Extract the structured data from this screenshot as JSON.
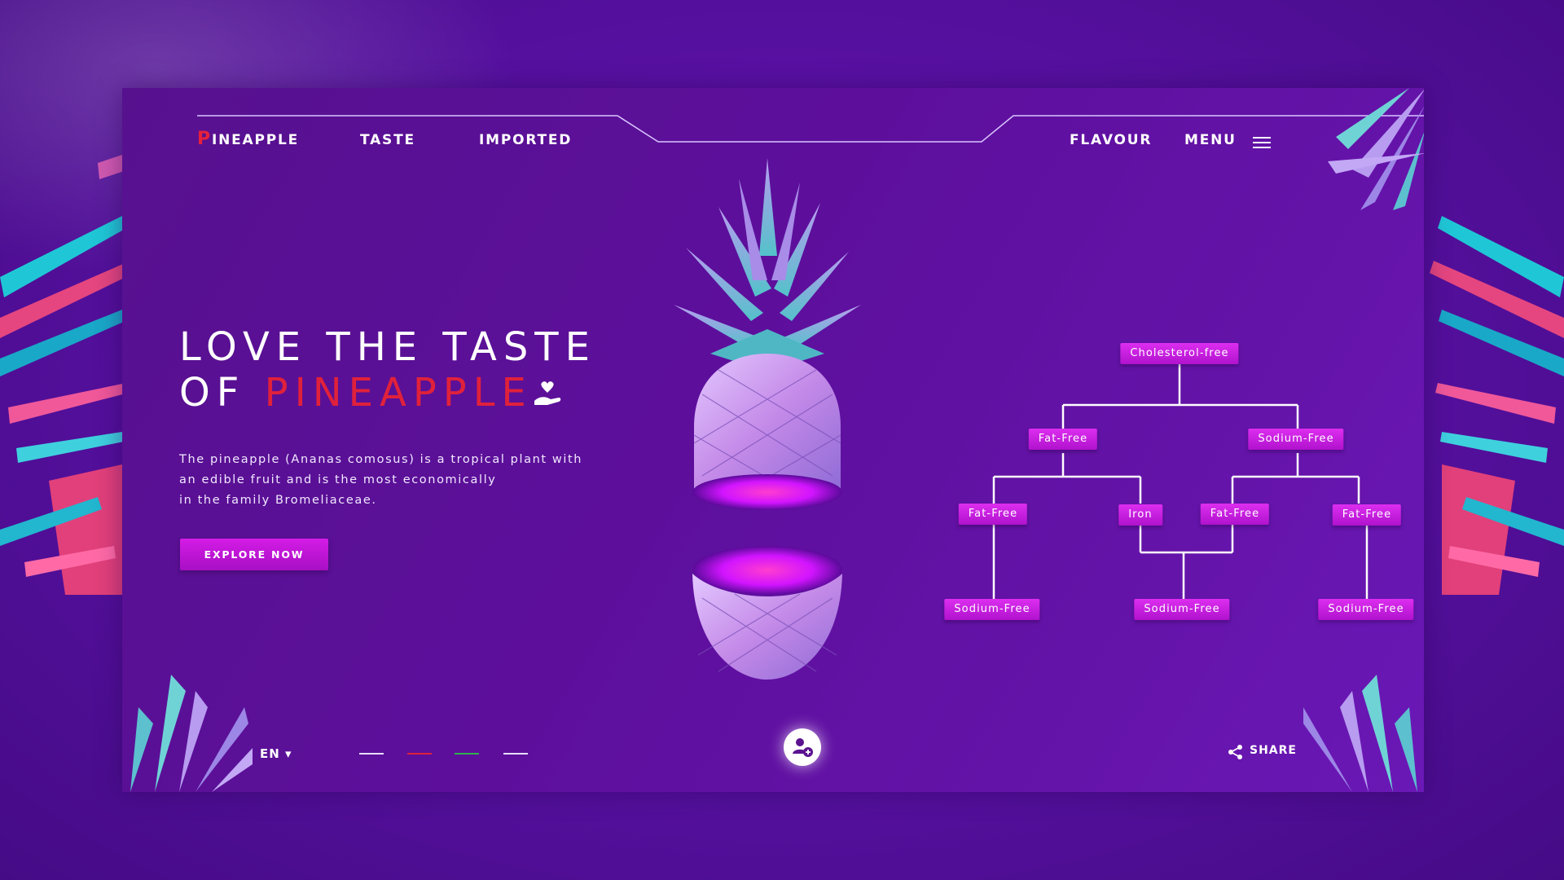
{
  "nav": {
    "logo_initial": "P",
    "logo_rest": "INEAPPLE",
    "taste": "TASTE",
    "imported": "IMPORTED",
    "flavour": "FLAVOUR",
    "menu": "MENU"
  },
  "hero": {
    "line1": "LOVE THE TASTE",
    "line2_prefix": "OF ",
    "line2_accent": "PINEAPPLE",
    "description": [
      "The pineapple (Ananas comosus) is a tropical plant with",
      "an edible fruit and is the most economically",
      "in the family Bromeliaceae."
    ],
    "cta": "EXPLORE NOW"
  },
  "tree": {
    "root": "Cholesterol-free",
    "level1": [
      "Fat-Free",
      "Sodium-Free"
    ],
    "level2": [
      "Fat-Free",
      "Iron",
      "Fat-Free",
      "Fat-Free"
    ],
    "level3": [
      "Sodium-Free",
      "Sodium-Free",
      "Sodium-Free"
    ]
  },
  "footer": {
    "language": "EN ▾",
    "share": "SHARE"
  },
  "colors": {
    "accent_red": "#e0213b",
    "button_magenta": "#c419dc",
    "background_purple": "#5d0f9c"
  }
}
